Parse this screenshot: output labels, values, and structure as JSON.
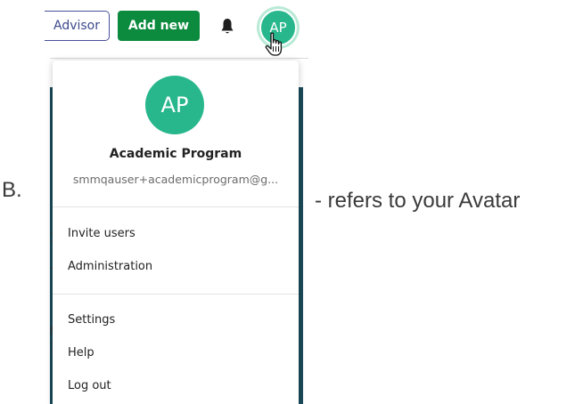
{
  "caption": {
    "letter": "B.",
    "description": "- refers to your Avatar"
  },
  "header": {
    "advisor_label": "Advisor",
    "add_new_label": "Add new",
    "avatar_initials": "AP"
  },
  "dropdown": {
    "avatar_initials": "AP",
    "name": "Academic Program",
    "email": "smmqauser+academicprogram@g...",
    "items_group1": [
      "Invite users",
      "Administration"
    ],
    "items_group2": [
      "Settings",
      "Help",
      "Log out"
    ]
  },
  "colors": {
    "brand_green": "#0c8a3e",
    "avatar_green": "#28b78c",
    "advisor_border": "#4a4f9a"
  }
}
